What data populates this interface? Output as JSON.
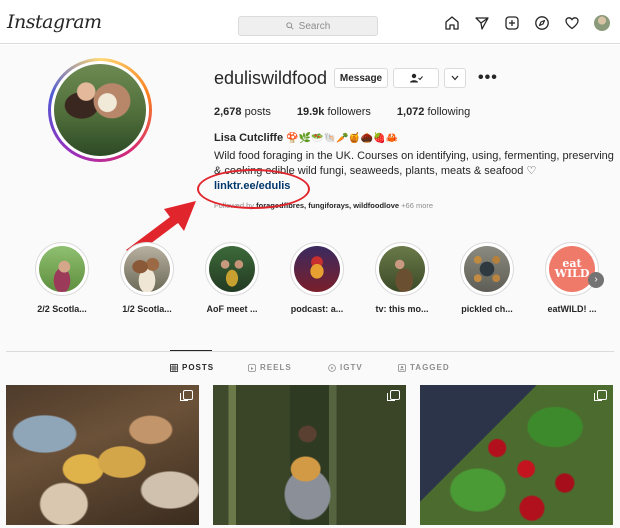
{
  "nav": {
    "logo": "Instagram",
    "search_placeholder": "Search",
    "icons": [
      "home-icon",
      "direct-icon",
      "new-post-icon",
      "explore-icon",
      "activity-icon",
      "profile-avatar"
    ]
  },
  "profile": {
    "username": "eduliswildfood",
    "buttons": {
      "message": "Message",
      "follow_icon": "following-person-check-icon",
      "dropdown_icon": "chevron-down-icon",
      "more": "•••"
    },
    "stats": {
      "posts": "2,678",
      "posts_label": "posts",
      "followers": "19.9k",
      "followers_label": "followers",
      "following": "1,072",
      "following_label": "following"
    },
    "full_name": "Lisa Cutcliffe",
    "name_emojis": "🍄🌿🥗🐚🥕🍯🌰🍓🦀",
    "bio": "Wild food foraging in the UK. Courses on identifying, using, fermenting, preserving & cooking edible wild fungi, seaweeds, plants, meats & seafood ♡",
    "link": "linktr.ee/edulis",
    "followed_by_prefix": "Followed by",
    "followed_by_names": "foragedfibres, fungiforays, wildfoodlove",
    "followed_by_more": "+66 more"
  },
  "annotation": {
    "color": "#e0262c"
  },
  "highlights": [
    {
      "label": "2/2 Scotla..."
    },
    {
      "label": "1/2 Scotla..."
    },
    {
      "label": "AoF meet ..."
    },
    {
      "label": "podcast: a..."
    },
    {
      "label": "tv: this mo..."
    },
    {
      "label": "pickled ch..."
    },
    {
      "label": "eatWILD! ...",
      "art_text": "eat WILD"
    }
  ],
  "tabs": [
    {
      "label": "POSTS",
      "active": true,
      "icon": "grid-icon"
    },
    {
      "label": "REELS",
      "active": false,
      "icon": "reels-icon"
    },
    {
      "label": "IGTV",
      "active": false,
      "icon": "igtv-icon"
    },
    {
      "label": "TAGGED",
      "active": false,
      "icon": "tagged-icon"
    }
  ],
  "posts": [
    {
      "name": "mushroom-spread-post",
      "multi": true
    },
    {
      "name": "woman-holding-fungus-post",
      "multi": true
    },
    {
      "name": "red-berries-post",
      "multi": true
    }
  ],
  "colors": {
    "link": "#00376b",
    "muted": "#8e8e8e",
    "border": "#dbdbdb",
    "text": "#262626"
  }
}
